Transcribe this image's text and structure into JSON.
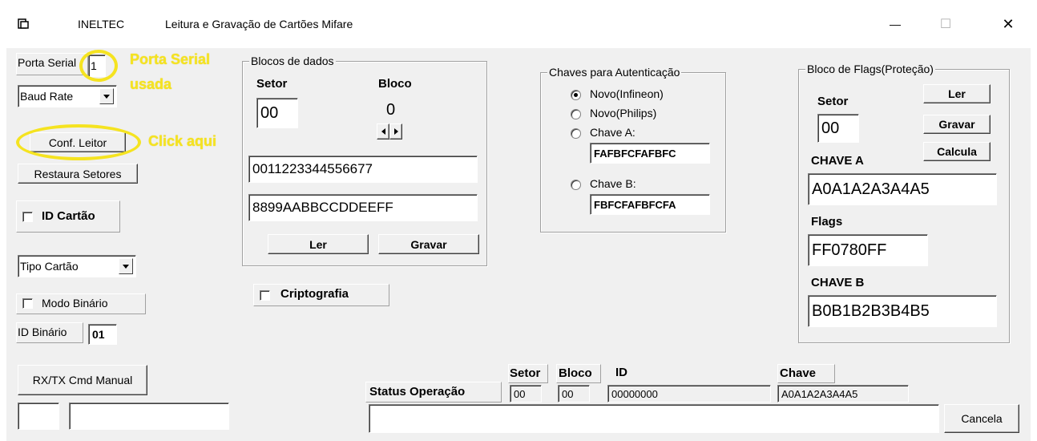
{
  "window": {
    "app_name": "INELTEC",
    "title": "Leitura e Gravação de Cartões Mifare",
    "minimize_glyph": "—",
    "maximize_glyph": "☐",
    "close_glyph": "✕"
  },
  "left": {
    "porta_serial_label": "Porta Serial",
    "porta_serial_value": "1",
    "baud_rate": "Baud Rate",
    "conf_leitor": "Conf. Leitor",
    "restaura_setores": "Restaura Setores",
    "id_cartao": "ID Cartão",
    "tipo_cartao": "Tipo Cartão",
    "modo_binario": "Modo Binário",
    "id_binario_label": "ID Binário",
    "id_binario_value": "01",
    "rx_tx": "RX/TX Cmd Manual",
    "small_box_value": "",
    "long_box_value": ""
  },
  "annotations": {
    "porta_line1": "Porta Serial",
    "porta_line2": "usada",
    "click_aqui": "Click aqui"
  },
  "blocos": {
    "title": "Blocos de dados",
    "setor_label": "Setor",
    "bloco_label": "Bloco",
    "setor_value": "00",
    "bloco_value": "0",
    "data1": "0011223344556677",
    "data2": "8899AABBCCDDEEFF",
    "ler": "Ler",
    "gravar": "Gravar",
    "criptografia": "Criptografia"
  },
  "chaves": {
    "title": "Chaves para Autenticação",
    "options": [
      "Novo(Infineon)",
      "Novo(Philips)",
      "Chave A:",
      "Chave B:"
    ],
    "selected": "Novo(Infineon)",
    "chave_a": "FAFBFCFAFBFC",
    "chave_b": "FBFCFAFBFCFA"
  },
  "flags": {
    "title": "Bloco de Flags(Proteção)",
    "setor_label": "Setor",
    "setor_value": "00",
    "ler": "Ler",
    "gravar": "Gravar",
    "calcula": "Calcula",
    "chave_a_label": "CHAVE A",
    "chave_a_value": "A0A1A2A3A4A5",
    "flags_label": "Flags",
    "flags_value": "FF0780FF",
    "chave_b_label": "CHAVE B",
    "chave_b_value": "B0B1B2B3B4B5"
  },
  "status": {
    "label": "Status Operação",
    "setor_label": "Setor",
    "bloco_label": "Bloco",
    "id_label": "ID",
    "chave_label": "Chave",
    "setor_value": "00",
    "bloco_value": "00",
    "id_value": "00000000",
    "chave_value": "A0A1A2A3A4A5",
    "message": "",
    "cancela": "Cancela"
  },
  "colors": {
    "annotation": "#f5e320",
    "background": "#f0f0f0"
  }
}
